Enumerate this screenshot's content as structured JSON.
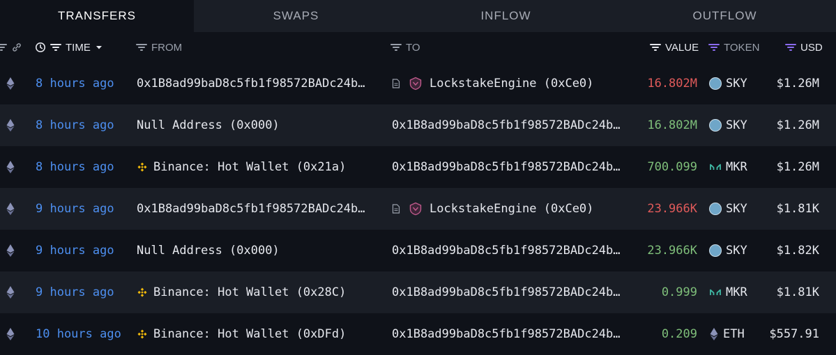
{
  "tabs": [
    {
      "label": "TRANSFERS",
      "active": true
    },
    {
      "label": "SWAPS",
      "active": false
    },
    {
      "label": "INFLOW",
      "active": false
    },
    {
      "label": "OUTFLOW",
      "active": false
    }
  ],
  "columns": {
    "time": "TIME",
    "from": "FROM",
    "to": "TO",
    "value": "VALUE",
    "token": "TOKEN",
    "usd": "USD"
  },
  "rows": [
    {
      "time": "8 hours ago",
      "from": "0x1B8ad99baD8c5fb1f98572BADc24b…",
      "to": "LockstakeEngine (0xCe0)",
      "value": "16.802M",
      "direction": "out",
      "token": "SKY",
      "usd": "$1.26M"
    },
    {
      "time": "8 hours ago",
      "from": "Null Address (0x000)",
      "to": "0x1B8ad99baD8c5fb1f98572BADc24b…",
      "value": "16.802M",
      "direction": "in",
      "token": "SKY",
      "usd": "$1.26M"
    },
    {
      "time": "8 hours ago",
      "from": "Binance: Hot Wallet (0x21a)",
      "to": "0x1B8ad99baD8c5fb1f98572BADc24b…",
      "value": "700.099",
      "direction": "in",
      "token": "MKR",
      "usd": "$1.26M"
    },
    {
      "time": "9 hours ago",
      "from": "0x1B8ad99baD8c5fb1f98572BADc24b…",
      "to": "LockstakeEngine (0xCe0)",
      "value": "23.966K",
      "direction": "out",
      "token": "SKY",
      "usd": "$1.81K"
    },
    {
      "time": "9 hours ago",
      "from": "Null Address (0x000)",
      "to": "0x1B8ad99baD8c5fb1f98572BADc24b…",
      "value": "23.966K",
      "direction": "in",
      "token": "SKY",
      "usd": "$1.82K"
    },
    {
      "time": "9 hours ago",
      "from": "Binance: Hot Wallet (0x28C)",
      "to": "0x1B8ad99baD8c5fb1f98572BADc24b…",
      "value": "0.999",
      "direction": "in",
      "token": "MKR",
      "usd": "$1.81K"
    },
    {
      "time": "10 hours ago",
      "from": "Binance: Hot Wallet (0xDFd)",
      "to": "0x1B8ad99baD8c5fb1f98572BADc24b…",
      "value": "0.209",
      "direction": "in",
      "token": "ETH",
      "usd": "$557.91"
    }
  ],
  "colors": {
    "time_link": "#4d8ff0",
    "value_out": "#e05a5a",
    "value_in": "#7fbf7a",
    "filter_accent": "#8b6cf0"
  }
}
